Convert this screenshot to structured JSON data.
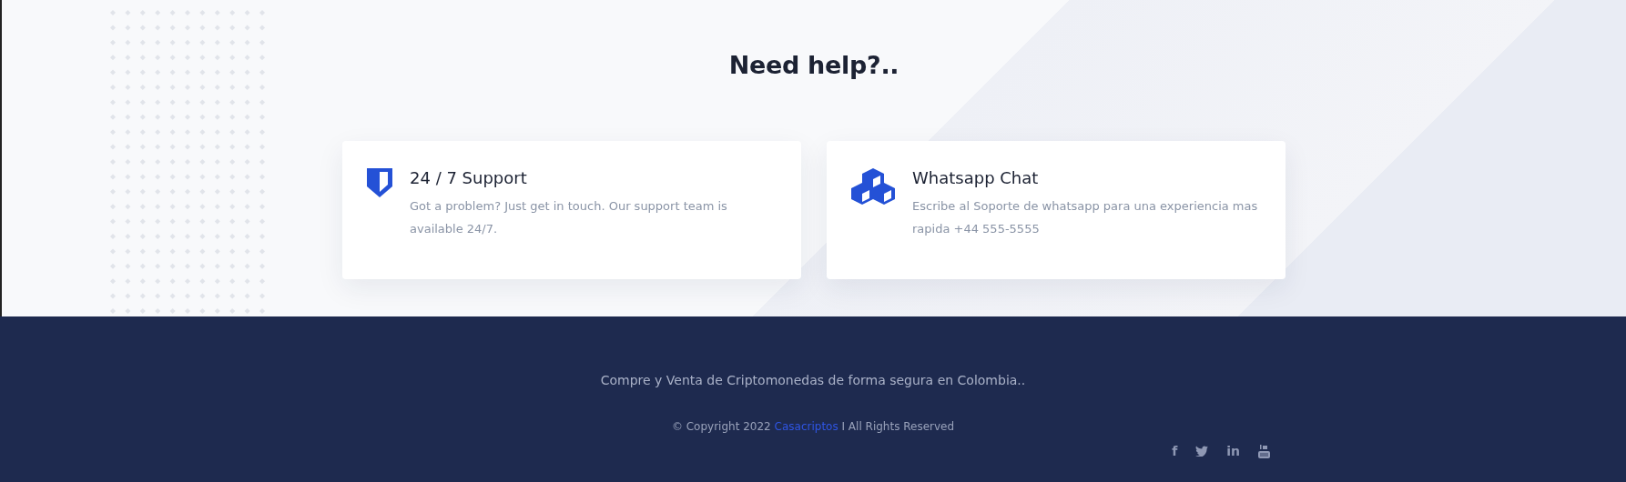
{
  "heading": "Need help?..",
  "cards": [
    {
      "kind": "shield",
      "title": "24 / 7 Support",
      "text": "Got a problem? Just get in touch. Our support team is available 24/7."
    },
    {
      "kind": "cubes",
      "title": "Whatsapp Chat",
      "text": "Escribe al Soporte de whatsapp para una experiencia mas rapida +44 555-5555"
    }
  ],
  "footer": {
    "tagline": "Compre y Venta de Criptomonedas de forma segura en Colombia..",
    "copyright": {
      "prefix": "© Copyright 2022",
      "link": "Casacriptos",
      "suffix": "I All Rights Reserved"
    },
    "social": [
      {
        "kind": "text",
        "label": "f"
      },
      {
        "kind": "bird"
      },
      {
        "kind": "text",
        "label": "in"
      },
      {
        "kind": "tube"
      }
    ]
  }
}
